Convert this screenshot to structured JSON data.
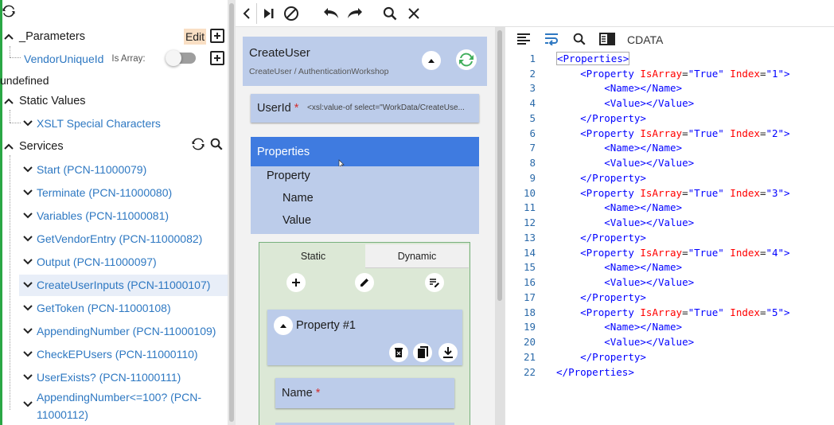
{
  "tree": {
    "parameters": {
      "label": "_Parameters",
      "edit": "Edit"
    },
    "vendor_param": {
      "label": "VendorUniqueId",
      "is_array": "Is Array:"
    },
    "undefined_text": "undefined",
    "static_values": {
      "label": "Static Values",
      "child": "XSLT Special Characters"
    },
    "services": {
      "label": "Services",
      "items": [
        "Start (PCN-11000079)",
        "Terminate (PCN-11000080)",
        "Variables (PCN-11000081)",
        "GetVendorEntry (PCN-11000082)",
        "Output (PCN-11000097)",
        "CreateUserInputs (PCN-11000107)",
        "GetToken (PCN-11000108)",
        "AppendingNumber (PCN-11000109)",
        "CheckEPUsers (PCN-11000110)",
        "UserExists? (PCN-11000111)",
        "AppendingNumber<=100? (PCN-",
        "11000112)"
      ]
    }
  },
  "form": {
    "card_title": "CreateUser",
    "card_sub": "CreateUser / AuthenticationWorkshop",
    "userid_label": "UserId",
    "userid_required": "*",
    "userid_value": "<xsl:value-of select=\"WorkData/CreateUse...",
    "props_label": "Properties",
    "props_tree": [
      "Property",
      "Name",
      "Value"
    ],
    "tab_static": "Static",
    "tab_dynamic": "Dynamic",
    "property_item": "Property #1",
    "name_label": "Name",
    "name_required": "*"
  },
  "code_panel": {
    "cdata": "CDATA",
    "line_numbers": [
      "1",
      "2",
      "3",
      "4",
      "5",
      "6",
      "7",
      "8",
      "9",
      "10",
      "11",
      "12",
      "13",
      "14",
      "15",
      "16",
      "17",
      "18",
      "19",
      "20",
      "21",
      "22"
    ],
    "kw": {
      "properties": "Properties",
      "property": "Property",
      "name": "Name",
      "value": "Value",
      "isarray": "IsArray",
      "index": "Index",
      "true": "\"True\""
    },
    "indices": [
      "\"1\"",
      "\"2\"",
      "\"3\"",
      "\"4\"",
      "\"5\""
    ]
  },
  "colors": {
    "accent_blue": "#3f7be0",
    "card_blue": "#bcccea",
    "link_blue": "#2e78c2",
    "tab_green": "#dce8d6",
    "edit_orange": "#f9dfc4"
  }
}
